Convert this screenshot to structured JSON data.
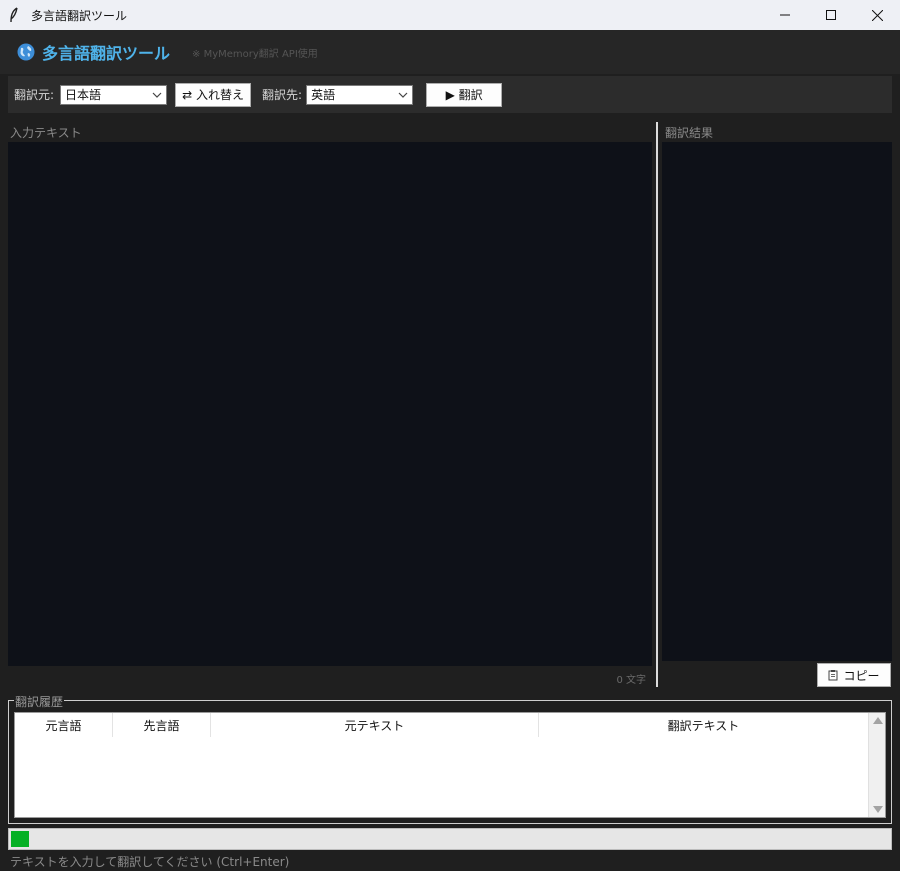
{
  "window": {
    "title": "多言語翻訳ツール"
  },
  "header": {
    "icon": "globe-icon",
    "title": "多言語翻訳ツール",
    "note": "※ MyMemory翻訳 API使用",
    "title_color": "#4fb3ea"
  },
  "toolbar": {
    "source_label": "翻訳元:",
    "source_value": "日本語",
    "swap_label": "⇄ 入れ替え",
    "target_label": "翻訳先:",
    "target_value": "英語",
    "translate_label": "▶ 翻訳"
  },
  "input_panel": {
    "label": "入力テキスト",
    "text": "",
    "char_count": "0 文字"
  },
  "output_panel": {
    "label": "翻訳結果",
    "text": "",
    "copy_label": "コピー",
    "copy_icon": "clipboard-icon"
  },
  "history": {
    "legend": "翻訳履歴",
    "columns": [
      "元言語",
      "先言語",
      "元テキスト",
      "翻訳テキスト"
    ],
    "rows": []
  },
  "progress": {
    "value_percent": 2,
    "color": "#06b025"
  },
  "status": {
    "text": "テキストを入力して翻訳してください (Ctrl+Enter)"
  }
}
